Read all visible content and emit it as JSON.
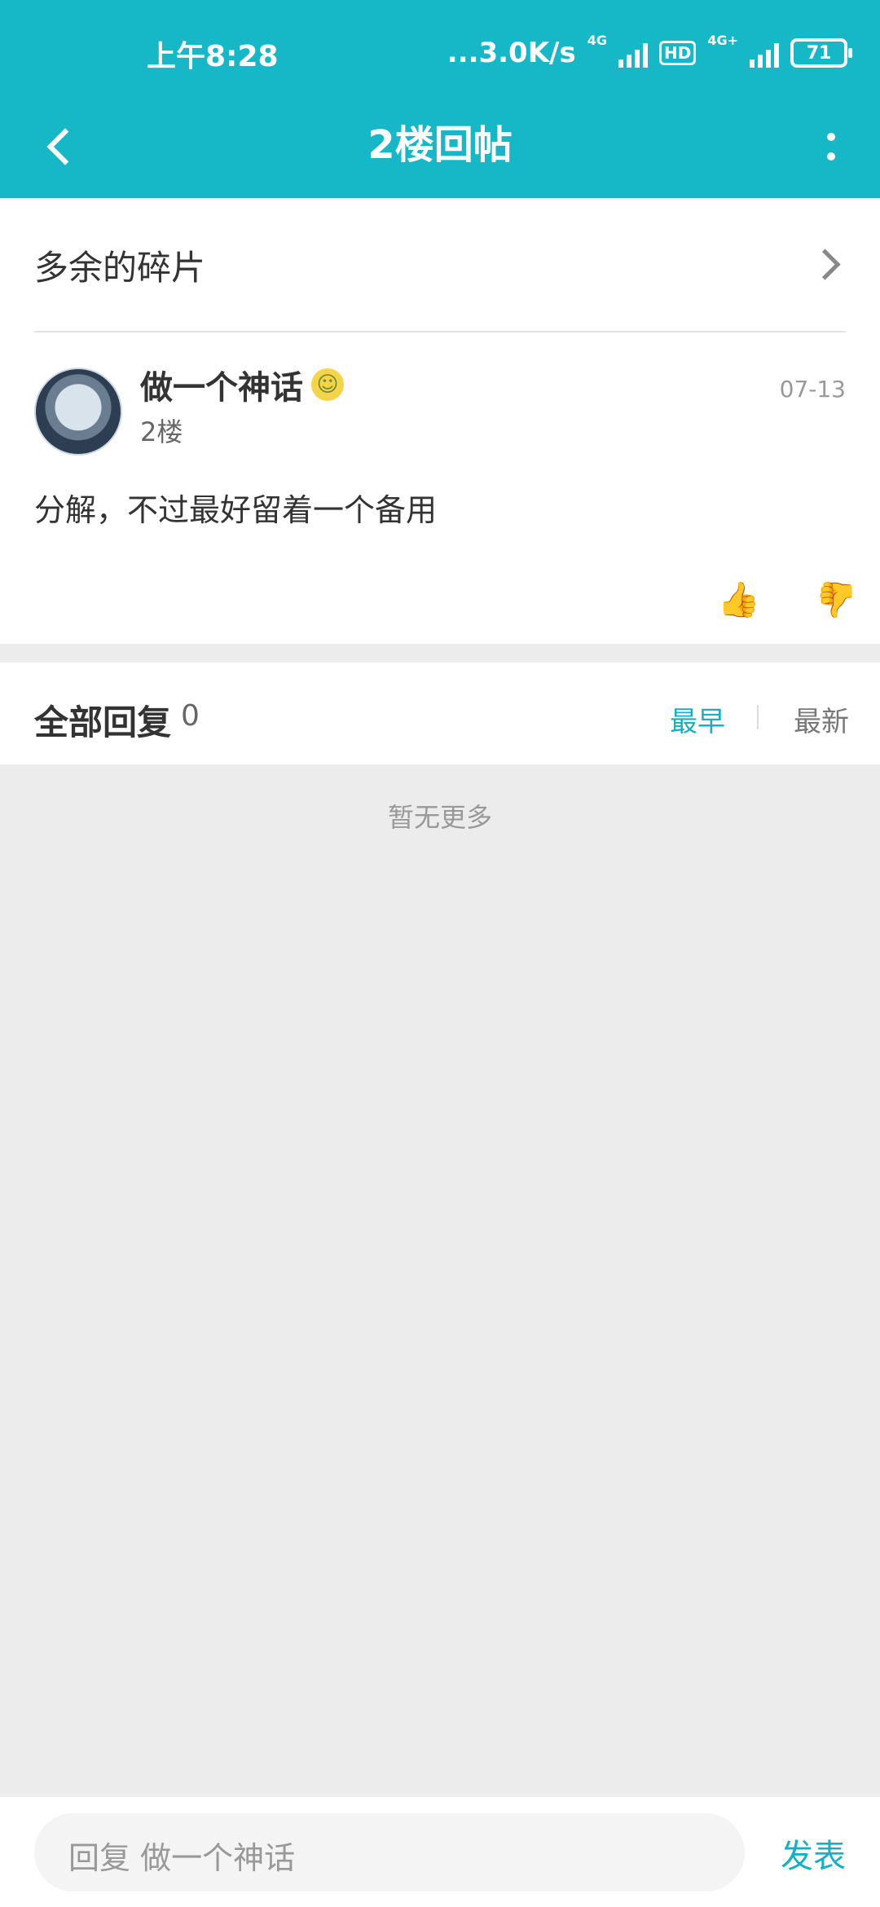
{
  "status_bar": {
    "time": "上午8:28",
    "network_speed": "...3.0K/s",
    "net_label_1": "4G",
    "hd_label": "HD",
    "net_label_2": "4G+",
    "battery": "71"
  },
  "header": {
    "title": "2楼回帖",
    "bg_color": "#16b8c8"
  },
  "post": {
    "source_title": "多余的碎片",
    "author": "做一个神话",
    "floor": "2楼",
    "date": "07-13",
    "content": "分解，不过最好留着一个备用",
    "like_icon": "thumb-up-icon",
    "dislike_icon": "thumb-down-icon"
  },
  "replies": {
    "label": "全部回复",
    "count": "0",
    "sort_earliest": "最早",
    "sort_latest": "最新",
    "empty_text": "暂无更多",
    "accent_color": "#16b0c2"
  },
  "bottom_bar": {
    "placeholder": "回复 做一个神话",
    "send_label": "发表"
  }
}
